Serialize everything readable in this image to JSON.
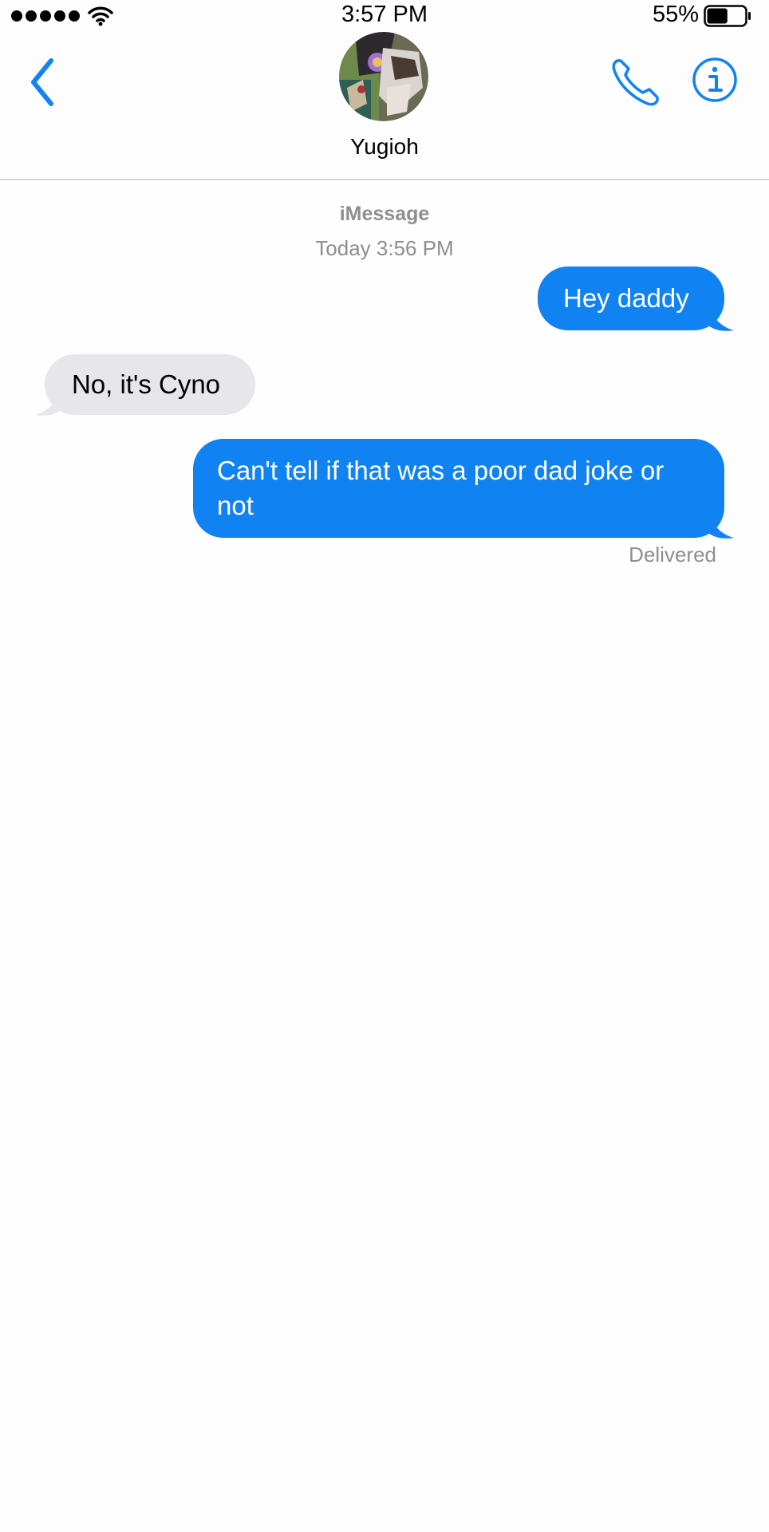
{
  "status_bar": {
    "time": "3:57 PM",
    "battery_percent": "55%",
    "battery_level": 0.55,
    "signal_bars": 5,
    "signal_icon": "signal-dots-icon",
    "wifi_icon": "wifi-icon",
    "battery_icon": "battery-icon"
  },
  "header": {
    "contact_name": "Yugioh",
    "back_icon": "chevron-left-icon",
    "call_icon": "phone-icon",
    "info_icon": "info-icon"
  },
  "conversation": {
    "service": "iMessage",
    "timestamp": "Today 3:56 PM",
    "messages": [
      {
        "direction": "outgoing",
        "text": "Hey daddy"
      },
      {
        "direction": "incoming",
        "text": "No, it's Cyno"
      },
      {
        "direction": "outgoing",
        "text": "Can't tell if that was a poor dad joke or not"
      }
    ],
    "delivery_status": "Delivered"
  },
  "colors": {
    "accent": "#1182f1",
    "incoming_bubble": "#e7e7eb",
    "secondary_text": "#8e8e93"
  }
}
